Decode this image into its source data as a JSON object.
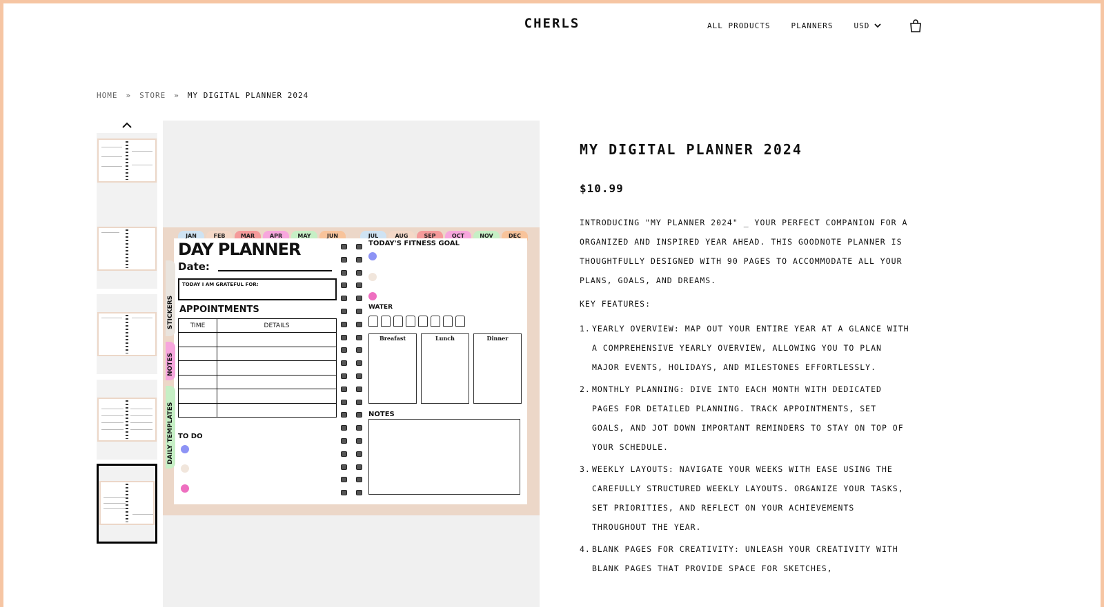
{
  "header": {
    "logo": "CHERLS",
    "nav": [
      "ALL PRODUCTS",
      "PLANNERS"
    ],
    "currency": "USD"
  },
  "breadcrumb": {
    "items": [
      "HOME",
      "STORE"
    ],
    "current": "MY DIGITAL PLANNER 2024"
  },
  "planner": {
    "months": [
      {
        "label": "JAN",
        "color": "#cfe3f3"
      },
      {
        "label": "FEB",
        "color": "#f4d8c7"
      },
      {
        "label": "MAR",
        "color": "#f59a9a"
      },
      {
        "label": "APR",
        "color": "#f7a6dd"
      },
      {
        "label": "MAY",
        "color": "#c6efc5"
      },
      {
        "label": "JUN",
        "color": "#f8c39a"
      },
      {
        "label": "JUL",
        "color": "#cfe3f3"
      },
      {
        "label": "AUG",
        "color": "#f4d8c7"
      },
      {
        "label": "SEP",
        "color": "#f59a9a"
      },
      {
        "label": "OCT",
        "color": "#f7a6dd"
      },
      {
        "label": "NOV",
        "color": "#c6efc5"
      },
      {
        "label": "DEC",
        "color": "#f8c39a"
      }
    ],
    "side_tabs": [
      {
        "label": "STICKERS",
        "color": "#e9e4de"
      },
      {
        "label": "NOTES",
        "color": "#f7a6dd"
      },
      {
        "label": "DAILY TEMPLATES",
        "color": "#c6efc5"
      }
    ],
    "title": "DAY PLANNER",
    "date_label": "Date:",
    "grateful_label": "TODAY I AM GRATEFUL FOR:",
    "appointments_label": "APPOINTMENTS",
    "time_label": "TIME",
    "details_label": "DETAILS",
    "todo_label": "TO DO",
    "fitness_label": "TODAY'S FITNESS GOAL",
    "water_label": "WATER",
    "meals": [
      "Breafast",
      "Lunch",
      "Dinner"
    ],
    "notes_label": "NOTES",
    "dot_colors": [
      "#8d93f5",
      "#f1e6dc",
      "#ee6fc0"
    ]
  },
  "product": {
    "title": "MY DIGITAL PLANNER 2024",
    "price": "$10.99",
    "description": "INTRODUCING \"MY PLANNER 2024\" _ YOUR PERFECT COMPANION FOR A ORGANIZED AND INSPIRED YEAR AHEAD. THIS GOODNOTE PLANNER IS THOUGHTFULLY DESIGNED WITH 90 PAGES TO ACCOMMODATE ALL YOUR PLANS, GOALS, AND DREAMS.",
    "features_label": "KEY FEATURES:",
    "features": [
      {
        "num": "1.",
        "text": "YEARLY OVERVIEW: MAP OUT YOUR ENTIRE YEAR AT A GLANCE WITH A COMPREHENSIVE YEARLY OVERVIEW, ALLOWING YOU TO PLAN MAJOR EVENTS, HOLIDAYS, AND MILESTONES EFFORTLESSLY."
      },
      {
        "num": "2.",
        "text": "MONTHLY PLANNING: DIVE INTO EACH MONTH WITH DEDICATED PAGES FOR DETAILED PLANNING. TRACK APPOINTMENTS, SET GOALS, AND JOT DOWN IMPORTANT REMINDERS TO STAY ON TOP OF YOUR SCHEDULE."
      },
      {
        "num": "3.",
        "text": "WEEKLY LAYOUTS: NAVIGATE YOUR WEEKS WITH EASE USING THE CAREFULLY STRUCTURED WEEKLY LAYOUTS. ORGANIZE YOUR TASKS, SET PRIORITIES, AND REFLECT ON YOUR ACHIEVEMENTS THROUGHOUT THE YEAR."
      },
      {
        "num": "4.",
        "text": "BLANK PAGES FOR CREATIVITY: UNLEASH YOUR CREATIVITY WITH BLANK PAGES THAT PROVIDE SPACE FOR SKETCHES,"
      }
    ]
  }
}
